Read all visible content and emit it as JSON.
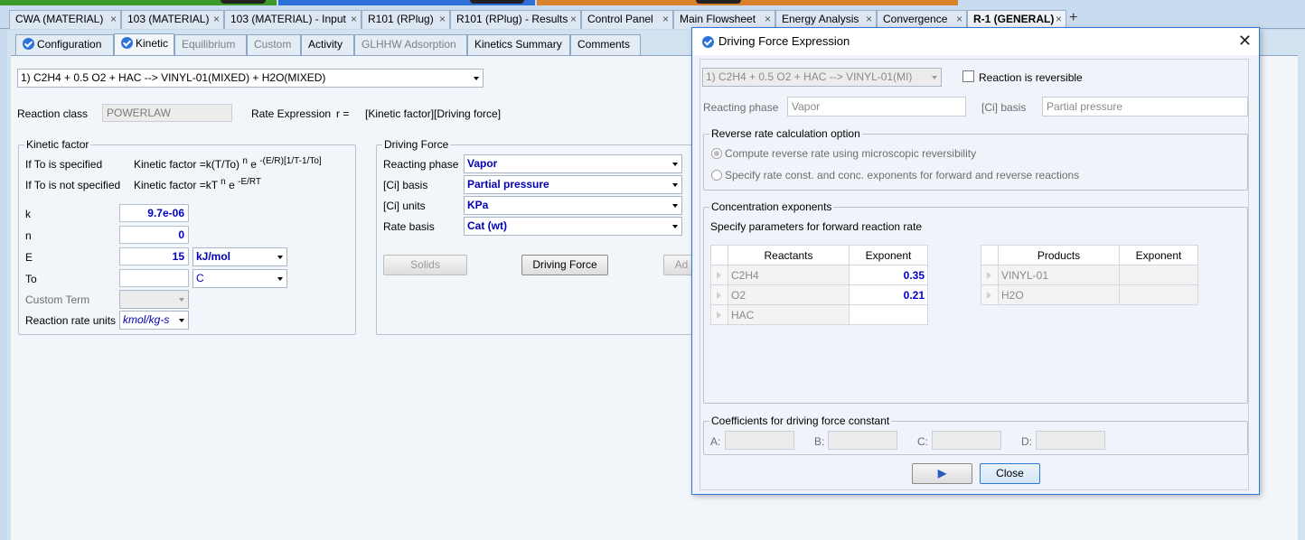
{
  "colors": {
    "strip_green": "#3a9a2a",
    "strip_blue": "#2c6fd8",
    "strip_orange": "#d9822b",
    "accent": "#0000c8"
  },
  "doc_tabs": [
    {
      "label": "CWA (MATERIAL)",
      "active": false
    },
    {
      "label": "103 (MATERIAL)",
      "active": false
    },
    {
      "label": "103 (MATERIAL) - Input",
      "active": false
    },
    {
      "label": "R101 (RPlug)",
      "active": false
    },
    {
      "label": "R101 (RPlug) - Results",
      "active": false
    },
    {
      "label": "Control Panel",
      "active": false
    },
    {
      "label": "Main Flowsheet",
      "active": false
    },
    {
      "label": "Energy Analysis",
      "active": false
    },
    {
      "label": "Convergence",
      "active": false
    },
    {
      "label": "R-1 (GENERAL)",
      "active": true
    }
  ],
  "tab_close_glyph": "×",
  "new_tab_glyph": "+",
  "form_tabs": [
    {
      "label": "Configuration",
      "icon": "check-circle-icon"
    },
    {
      "label": "Kinetic",
      "icon": "check-circle-icon"
    },
    {
      "label": "Equilibrium"
    },
    {
      "label": "Custom"
    },
    {
      "label": "Activity"
    },
    {
      "label": "GLHHW Adsorption"
    },
    {
      "label": "Kinetics Summary"
    },
    {
      "label": "Comments"
    }
  ],
  "reaction_select": "1) C2H4  + 0.5 O2  + HAC   -->  VINYL-01(MIXED) + H2O(MIXED)",
  "reaction_class": {
    "label": "Reaction class",
    "value": "POWERLAW"
  },
  "rate_expression": {
    "label": "Rate Expression",
    "r": "r =",
    "value": "[Kinetic factor][Driving force]"
  },
  "kinetic_factor": {
    "title": "Kinetic factor",
    "if_to_specified": "If To is specified",
    "if_to_not_specified": "If To is not specified",
    "formula1_prefix": "Kinetic factor =k(T/To)",
    "formula1_n": "n",
    "formula1_e": "e",
    "formula1_exp": "-(E/R)[1/T-1/To]",
    "formula2_prefix": "Kinetic factor =kT",
    "formula2_n": "n",
    "formula2_e": "e",
    "formula2_exp": "-E/RT",
    "k_label": "k",
    "k_value": "9.7e-06",
    "n_label": "n",
    "n_value": "0",
    "E_label": "E",
    "E_value": "15",
    "E_unit": "kJ/mol",
    "To_label": "To",
    "To_value": "",
    "To_unit": "C",
    "custom_term_label": "Custom Term",
    "rate_units_label": "Reaction rate units",
    "rate_units_value": "kmol/kg-s"
  },
  "driving_force": {
    "title": "Driving Force",
    "reacting_phase_label": "Reacting phase",
    "reacting_phase": "Vapor",
    "ci_basis_label": "[Ci] basis",
    "ci_basis": "Partial pressure",
    "ci_units_label": "[Ci] units",
    "ci_units": "KPa",
    "rate_basis_label": "Rate basis",
    "rate_basis": "Cat (wt)",
    "solids_button": "Solids",
    "driving_force_button": "Driving Force",
    "partial_button": "Ad"
  },
  "dialog": {
    "title": "Driving Force Expression",
    "close_glyph": "✕",
    "reaction_select": "1) C2H4  + 0.5 O2  + HAC   -->  VINYL-01(MI)",
    "reversible_label": "Reaction is reversible",
    "reacting_phase_label": "Reacting phase",
    "reacting_phase": "Vapor",
    "ci_basis_label": "[Ci] basis",
    "ci_basis": "Partial pressure",
    "reverse_option": {
      "title": "Reverse rate calculation option",
      "opt1": "Compute reverse rate using microscopic  reversibility",
      "opt2": "Specify rate const. and conc. exponents for forward and reverse reactions"
    },
    "conc_exponents": {
      "title": "Concentration exponents",
      "subtitle": "Specify parameters for forward reaction rate",
      "reactants_header": "Reactants",
      "exponent_header": "Exponent",
      "reactants": [
        {
          "name": "C2H4",
          "exp": "0.35"
        },
        {
          "name": "O2",
          "exp": "0.21"
        },
        {
          "name": "HAC",
          "exp": ""
        }
      ],
      "products_header": "Products",
      "products_exp_header": "Exponent",
      "products": [
        {
          "name": "VINYL-01",
          "exp": ""
        },
        {
          "name": "H2O",
          "exp": ""
        }
      ]
    },
    "coefficients": {
      "title": "Coefficients for driving force constant",
      "A": "A:",
      "B": "B:",
      "C": "C:",
      "D": "D:"
    },
    "next_button": "▶",
    "close_button": "Close"
  }
}
